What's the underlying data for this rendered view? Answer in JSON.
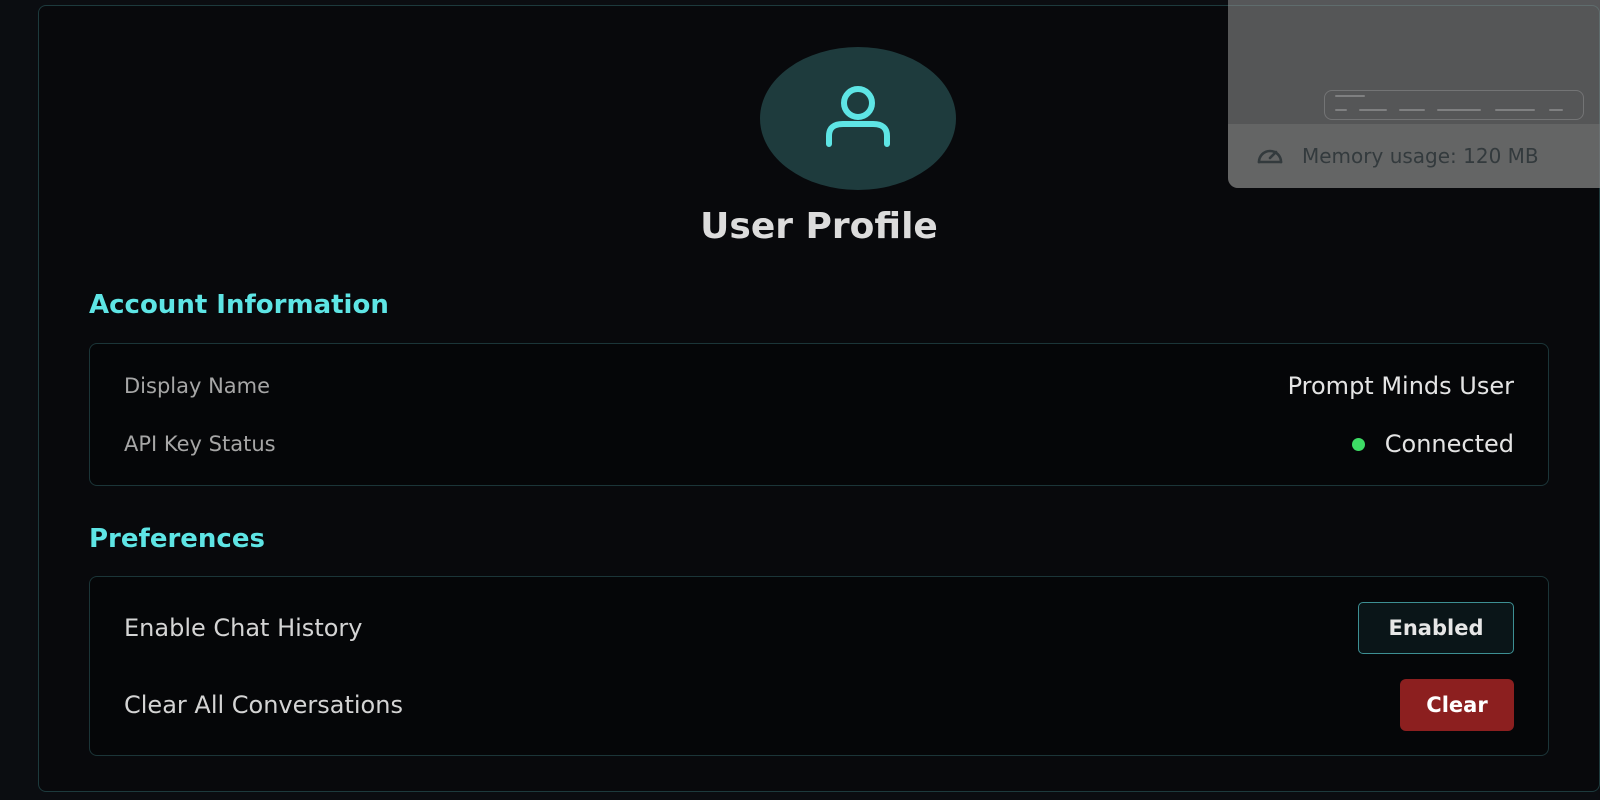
{
  "profile": {
    "title": "User Profile",
    "avatar_icon": "user-icon"
  },
  "account": {
    "heading": "Account Information",
    "display_name_label": "Display Name",
    "display_name_value": "Prompt Minds User",
    "api_key_label": "API Key Status",
    "api_key_value": "Connected",
    "api_key_status_color": "#3ddc65"
  },
  "preferences": {
    "heading": "Preferences",
    "chat_history_label": "Enable Chat History",
    "chat_history_button": "Enabled",
    "clear_label": "Clear All Conversations",
    "clear_button": "Clear"
  },
  "overlay": {
    "memory_icon": "gauge-icon",
    "memory_text": "Memory usage: 120 MB"
  },
  "colors": {
    "accent": "#5ee5e5",
    "danger": "#8c1f1f",
    "success": "#3ddc65"
  }
}
